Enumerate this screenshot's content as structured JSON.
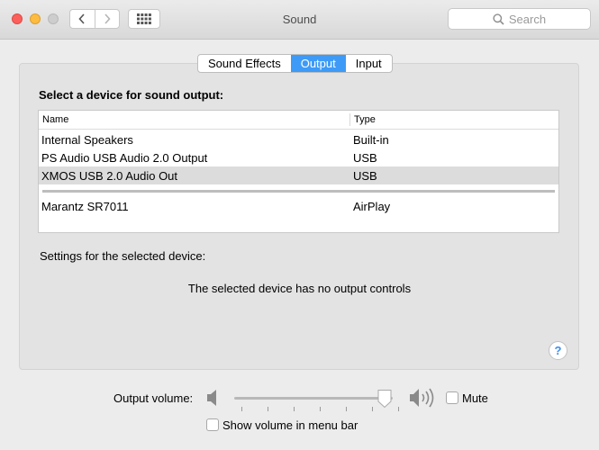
{
  "window": {
    "title": "Sound"
  },
  "search": {
    "placeholder": "Search",
    "icon": "magnifier-icon"
  },
  "tabs": [
    {
      "label": "Sound Effects",
      "selected": false
    },
    {
      "label": "Output",
      "selected": true
    },
    {
      "label": "Input",
      "selected": false
    }
  ],
  "output": {
    "heading": "Select a device for sound output:",
    "columns": {
      "name": "Name",
      "type": "Type"
    },
    "devices": [
      {
        "name": "Internal Speakers",
        "type": "Built-in"
      },
      {
        "name": "PS Audio USB Audio 2.0 Output",
        "type": "USB"
      },
      {
        "name": "XMOS USB 2.0 Audio Out",
        "type": "USB",
        "selected": true
      },
      {
        "name": "Marantz SR7011",
        "type": "AirPlay"
      }
    ],
    "settings_label": "Settings for the selected device:",
    "no_controls_text": "The selected device has no output controls",
    "help_label": "?"
  },
  "volume": {
    "label": "Output volume:",
    "level_fraction": 0.95,
    "mute_label": "Mute",
    "mute_checked": false,
    "menu_bar_label": "Show volume in menu bar",
    "menu_bar_checked": false
  },
  "colors": {
    "accent": "#3d9bf7",
    "close": "#fc605c",
    "minimize": "#fdbc40",
    "zoom": "#cdcdcd"
  }
}
